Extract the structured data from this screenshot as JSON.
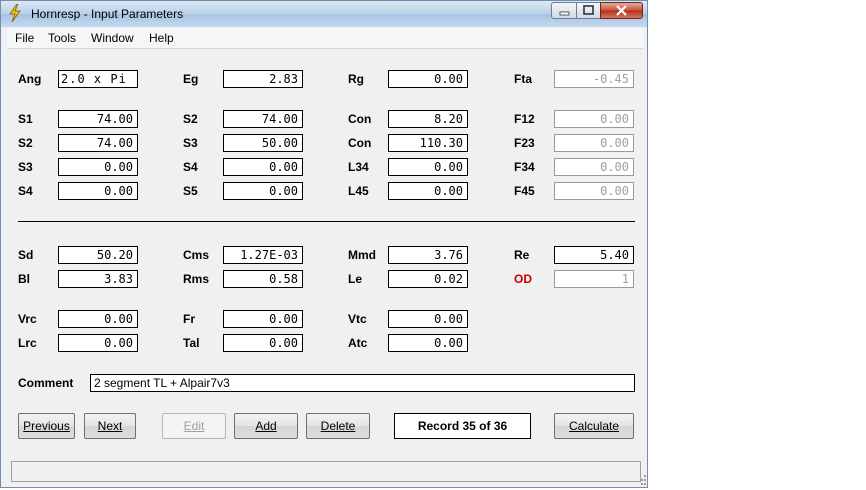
{
  "window": {
    "title": "Hornresp - Input Parameters"
  },
  "menu": [
    "File",
    "Tools",
    "Window",
    "Help"
  ],
  "fields": {
    "ang": {
      "label": "Ang",
      "value": "2.0 x Pi"
    },
    "eg": {
      "label": "Eg",
      "value": "2.83"
    },
    "rg": {
      "label": "Rg",
      "value": "0.00"
    },
    "fta": {
      "label": "Fta",
      "value": "-0.45"
    },
    "s1": {
      "label": "S1",
      "value": "74.00"
    },
    "s2a": {
      "label": "S2",
      "value": "74.00"
    },
    "con1": {
      "label": "Con",
      "value": "8.20"
    },
    "f12": {
      "label": "F12",
      "value": "0.00"
    },
    "s2b": {
      "label": "S2",
      "value": "74.00"
    },
    "s3a": {
      "label": "S3",
      "value": "50.00"
    },
    "con2": {
      "label": "Con",
      "value": "110.30"
    },
    "f23": {
      "label": "F23",
      "value": "0.00"
    },
    "s3b": {
      "label": "S3",
      "value": "0.00"
    },
    "s4a": {
      "label": "S4",
      "value": "0.00"
    },
    "l34": {
      "label": "L34",
      "value": "0.00"
    },
    "f34": {
      "label": "F34",
      "value": "0.00"
    },
    "s4b": {
      "label": "S4",
      "value": "0.00"
    },
    "s5": {
      "label": "S5",
      "value": "0.00"
    },
    "l45": {
      "label": "L45",
      "value": "0.00"
    },
    "f45": {
      "label": "F45",
      "value": "0.00"
    },
    "sd": {
      "label": "Sd",
      "value": "50.20"
    },
    "cms": {
      "label": "Cms",
      "value": "1.27E-03"
    },
    "mmd": {
      "label": "Mmd",
      "value": "3.76"
    },
    "re": {
      "label": "Re",
      "value": "5.40"
    },
    "bl": {
      "label": "Bl",
      "value": "3.83"
    },
    "rms": {
      "label": "Rms",
      "value": "0.58"
    },
    "le": {
      "label": "Le",
      "value": "0.02"
    },
    "od": {
      "label": "OD",
      "value": "1"
    },
    "vrc": {
      "label": "Vrc",
      "value": "0.00"
    },
    "fr": {
      "label": "Fr",
      "value": "0.00"
    },
    "vtc": {
      "label": "Vtc",
      "value": "0.00"
    },
    "lrc": {
      "label": "Lrc",
      "value": "0.00"
    },
    "tal": {
      "label": "Tal",
      "value": "0.00"
    },
    "atc": {
      "label": "Atc",
      "value": "0.00"
    }
  },
  "comment": {
    "label": "Comment",
    "value": "2 segment TL + Alpair7v3"
  },
  "buttons": {
    "previous": "Previous",
    "next": "Next",
    "edit": "Edit",
    "add": "Add",
    "delete": "Delete",
    "calculate": "Calculate"
  },
  "record": "Record 35 of 36",
  "colors": {
    "od_label": "#cc0000",
    "disabled_text": "#a0a0a0"
  }
}
